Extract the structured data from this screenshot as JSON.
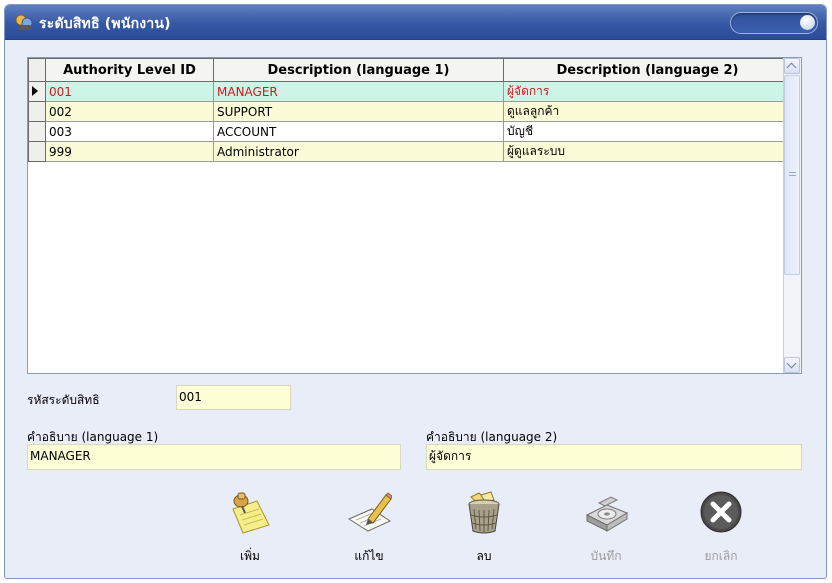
{
  "window": {
    "title": "ระดับสิทธิ (พนักงาน)"
  },
  "grid": {
    "columns": [
      "Authority Level ID",
      "Description (language 1)",
      "Description (language 2)"
    ],
    "rows": [
      {
        "id": "001",
        "desc1": "MANAGER",
        "desc2": "ผู้จัดการ",
        "selected": true
      },
      {
        "id": "002",
        "desc1": "SUPPORT",
        "desc2": "ดูแลลูกค้า",
        "selected": false
      },
      {
        "id": "003",
        "desc1": "ACCOUNT",
        "desc2": "บัญชี",
        "selected": false
      },
      {
        "id": "999",
        "desc1": "Administrator",
        "desc2": "ผู้ดูแลระบบ",
        "selected": false
      }
    ]
  },
  "form": {
    "id_label": "รหัสระดับสิทธิ",
    "id_value": "001",
    "desc1_label": "คำอธิบาย (language 1)",
    "desc1_value": "MANAGER",
    "desc2_label": "คำอธิบาย (language 2)",
    "desc2_value": "ผู้จัดการ"
  },
  "actions": {
    "add": "เพิ่ม",
    "edit": "แก้ไข",
    "delete": "ลบ",
    "save": "บันทึก",
    "cancel": "ยกเลิก"
  },
  "colors": {
    "selected_row_bg": "#ccf5e8",
    "selected_row_text": "#d1181f",
    "alt_row_bg": "#fbfbd8",
    "field_bg": "#fdfdd6",
    "titlebar": "#3658a4"
  },
  "icons": {
    "title": "people-key-icon",
    "add": "pushpin-note-icon",
    "edit": "pencil-paper-icon",
    "delete": "wastebasket-icon",
    "save": "disk-drive-icon",
    "cancel": "close-circle-icon"
  }
}
